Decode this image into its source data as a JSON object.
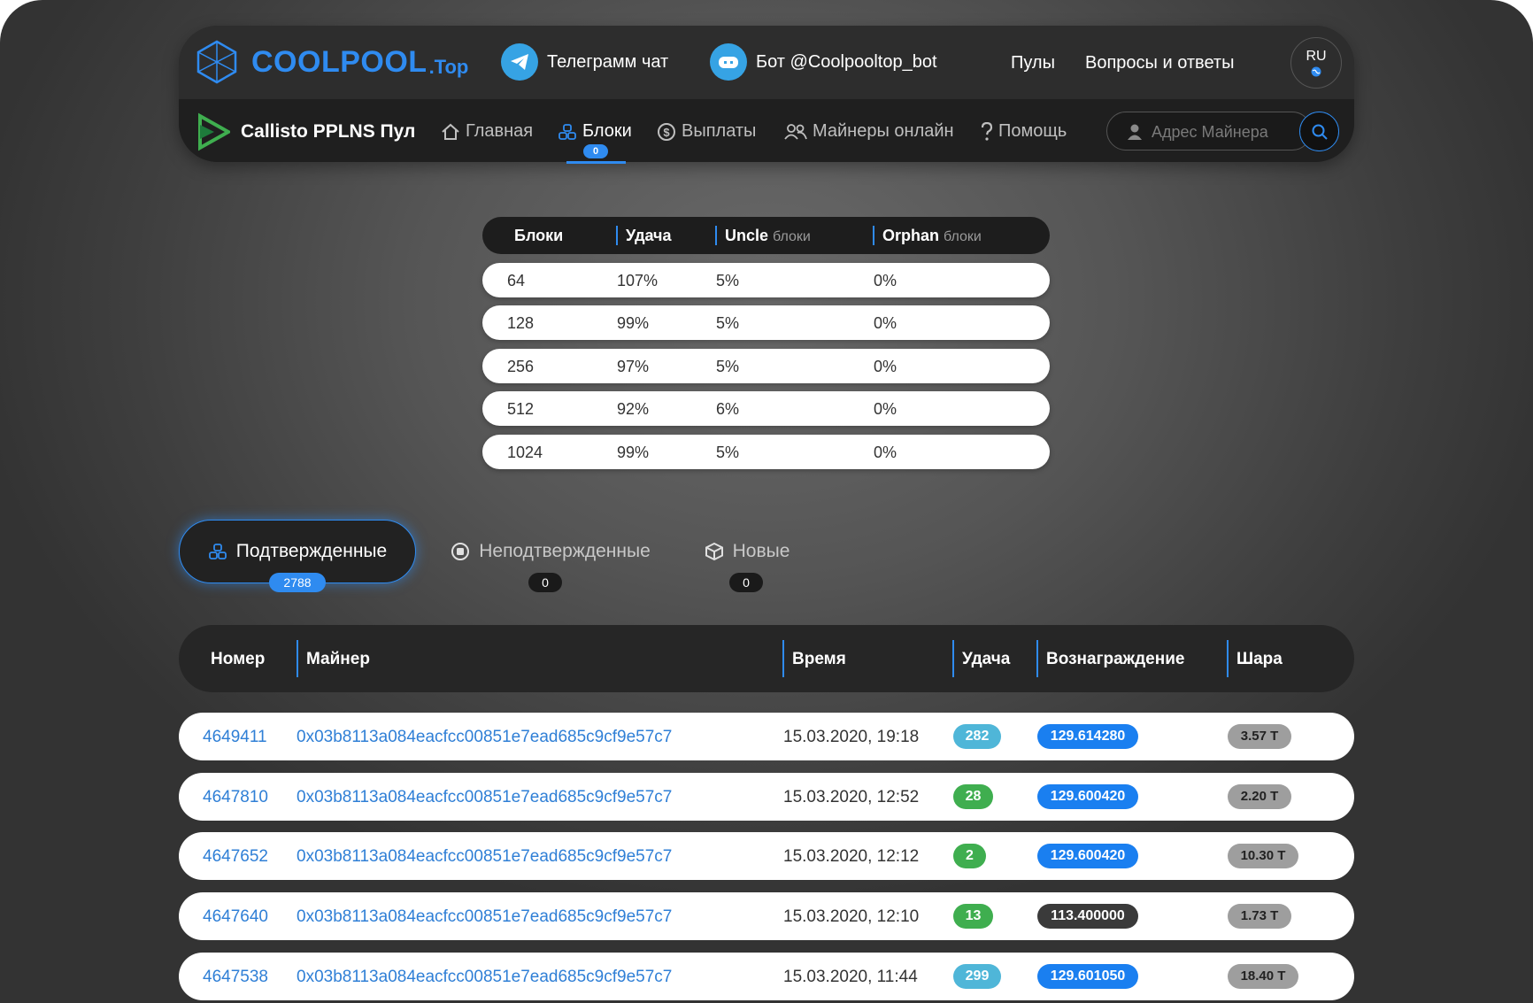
{
  "header": {
    "logo_text": "COOLPOOL",
    "logo_sub": ".Top",
    "telegram_chat": "Телеграмм чат",
    "bot": "Бот @Coolpooltop_bot",
    "pools": "Пулы",
    "faq": "Вопросы и ответы",
    "lang": "RU"
  },
  "subheader": {
    "pool_name": "Callisto PPLNS Пул",
    "nav": [
      "Главная",
      "Блоки",
      "Выплаты",
      "Майнеры онлайн",
      "Помощь"
    ],
    "blocks_badge": "0",
    "search_placeholder": "Адрес Майнера"
  },
  "stats": {
    "headers": [
      "Блоки",
      "Удача",
      "Uncle",
      "блоки",
      "Orphan",
      "блоки"
    ],
    "rows": [
      [
        "64",
        "107%",
        "5%",
        "0%"
      ],
      [
        "128",
        "99%",
        "5%",
        "0%"
      ],
      [
        "256",
        "97%",
        "5%",
        "0%"
      ],
      [
        "512",
        "92%",
        "6%",
        "0%"
      ],
      [
        "1024",
        "99%",
        "5%",
        "0%"
      ]
    ]
  },
  "tabs": [
    {
      "label": "Подтвержденные",
      "count": "2788"
    },
    {
      "label": "Неподтвержденные",
      "count": "0"
    },
    {
      "label": "Новые",
      "count": "0"
    }
  ],
  "table": {
    "headers": [
      "Номер",
      "Майнер",
      "Время",
      "Удача",
      "Вознаграждение",
      "Шара"
    ],
    "rows": [
      {
        "num": "4649411",
        "miner": "0x03b8113a084eacfcc00851e7ead685c9cf9e57c7",
        "time": "15.03.2020, 19:18",
        "luck": "282",
        "reward": "129.614280",
        "share": "3.57 T"
      },
      {
        "num": "4647810",
        "miner": "0x03b8113a084eacfcc00851e7ead685c9cf9e57c7",
        "time": "15.03.2020, 12:52",
        "luck": "28",
        "reward": "129.600420",
        "share": "2.20 T"
      },
      {
        "num": "4647652",
        "miner": "0x03b8113a084eacfcc00851e7ead685c9cf9e57c7",
        "time": "15.03.2020, 12:12",
        "luck": "2",
        "reward": "129.600420",
        "share": "10.30 T"
      },
      {
        "num": "4647640",
        "miner": "0x03b8113a084eacfcc00851e7ead685c9cf9e57c7",
        "time": "15.03.2020, 12:10",
        "luck": "13",
        "reward": "113.400000",
        "share": "1.73 T"
      },
      {
        "num": "4647538",
        "miner": "0x03b8113a084eacfcc00851e7ead685c9cf9e57c7",
        "time": "15.03.2020, 11:44",
        "luck": "299",
        "reward": "129.601050",
        "share": "18.40 T"
      }
    ]
  },
  "colors": {
    "accent": "#2f8bf0",
    "luck_high": "#4fb6d8",
    "luck_low": "#3fae4f",
    "reward_blue": "#1a7ff0",
    "reward_dark": "#3a3a3a",
    "share_gray": "#9e9e9e"
  }
}
